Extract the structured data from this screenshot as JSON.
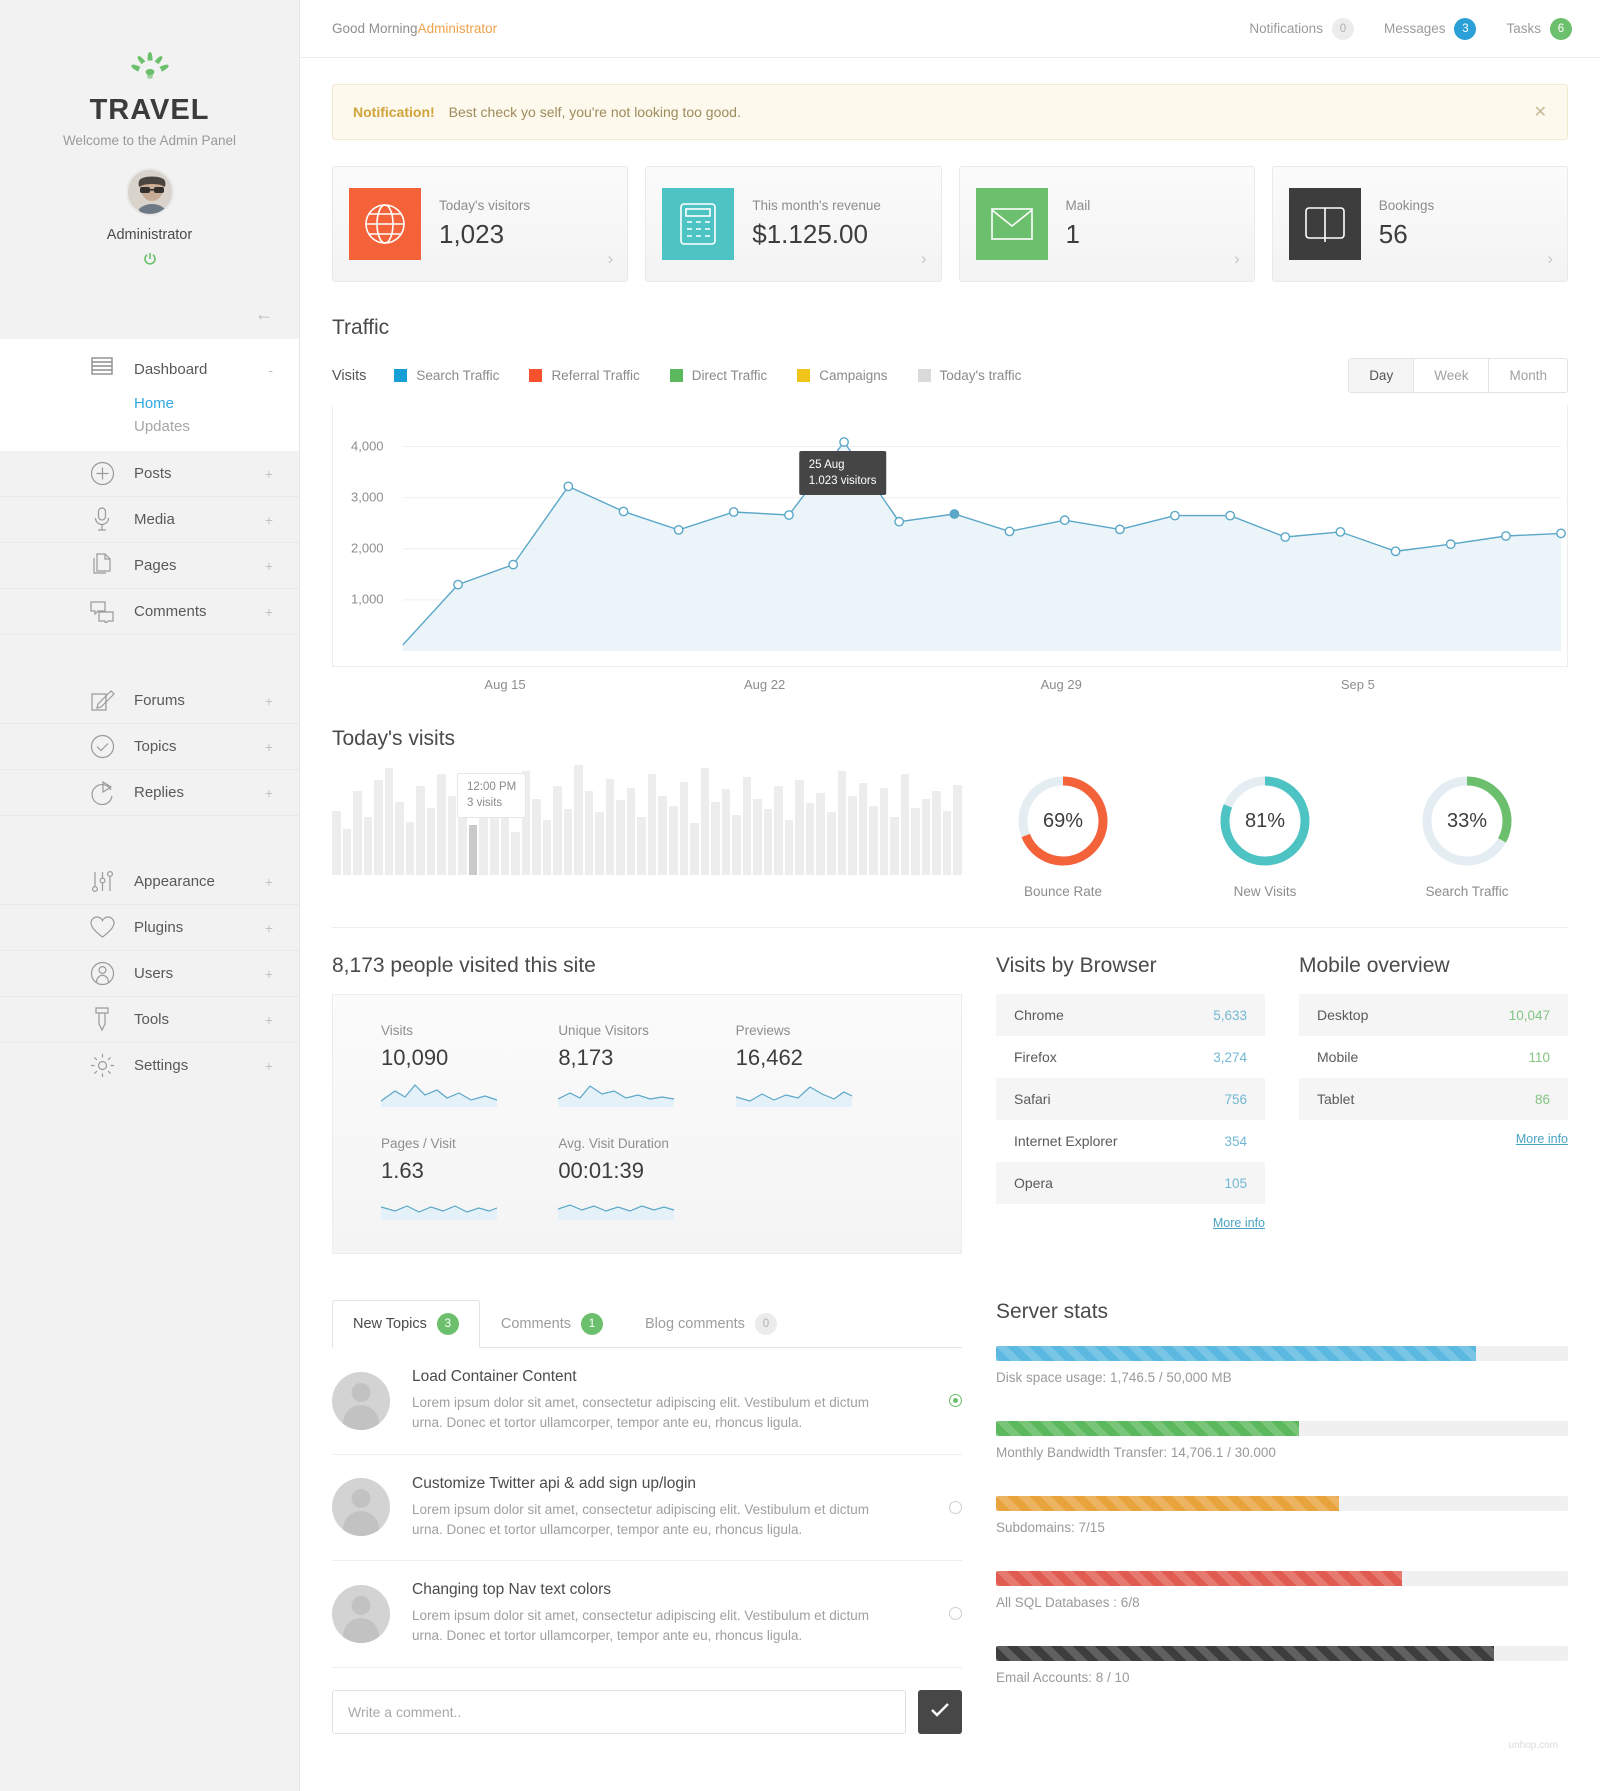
{
  "brand": {
    "name": "TRAVEL",
    "tagline": "Welcome to the Admin Panel",
    "user": "Administrator",
    "logo_icon": "palm-tree-icon",
    "power_icon": "power-icon",
    "collapse_icon": "arrow-left-icon"
  },
  "sidebar": {
    "dashboard": {
      "label": "Dashboard",
      "icon": "lines-icon",
      "toggle": "-",
      "sub": [
        {
          "label": "Home",
          "selected": true
        },
        {
          "label": "Updates",
          "selected": false
        }
      ]
    },
    "group1": [
      {
        "label": "Posts",
        "icon": "plus-circle-icon",
        "toggle": "+"
      },
      {
        "label": "Media",
        "icon": "microphone-icon",
        "toggle": "+"
      },
      {
        "label": "Pages",
        "icon": "pages-icon",
        "toggle": "+"
      },
      {
        "label": "Comments",
        "icon": "comments-icon",
        "toggle": "+"
      }
    ],
    "group2": [
      {
        "label": "Forums",
        "icon": "pencil-square-icon",
        "toggle": "+"
      },
      {
        "label": "Topics",
        "icon": "check-circle-icon",
        "toggle": "+"
      },
      {
        "label": "Replies",
        "icon": "reply-arrow-icon",
        "toggle": "+"
      }
    ],
    "group3": [
      {
        "label": "Appearance",
        "icon": "sliders-icon",
        "toggle": "+"
      },
      {
        "label": "Plugins",
        "icon": "heart-icon",
        "toggle": "+"
      },
      {
        "label": "Users",
        "icon": "user-icon",
        "toggle": "+"
      },
      {
        "label": "Tools",
        "icon": "tool-icon",
        "toggle": "+"
      },
      {
        "label": "Settings",
        "icon": "gear-icon",
        "toggle": "+"
      }
    ]
  },
  "topbar": {
    "greeting": "Good Morning ",
    "greeting_user": "Administrator",
    "items": [
      {
        "label": "Notifications",
        "count": "0",
        "style": "grey"
      },
      {
        "label": "Messages",
        "count": "3",
        "style": "blue"
      },
      {
        "label": "Tasks",
        "count": "6",
        "style": "green"
      }
    ]
  },
  "notification": {
    "title": "Notification!",
    "message": "Best check yo self, you're not looking too good.",
    "close_icon": "close-icon"
  },
  "cards": [
    {
      "label": "Today's visitors",
      "value": "1,023",
      "icon": "globe-icon",
      "color": "#f4623a"
    },
    {
      "label": "This month's revenue",
      "value": "$1.125.00",
      "icon": "calculator-icon",
      "color": "#4ec3c3"
    },
    {
      "label": "Mail",
      "value": "1",
      "icon": "envelope-icon",
      "color": "#6cbf6c"
    },
    {
      "label": "Bookings",
      "value": "56",
      "icon": "book-icon",
      "color": "#3d3d3d"
    }
  ],
  "traffic": {
    "title": "Traffic",
    "legend_first": "Visits",
    "legend": [
      {
        "label": "Search Traffic",
        "color": "#159fd4"
      },
      {
        "label": "Referral Traffic",
        "color": "#f4512c"
      },
      {
        "label": "Direct Traffic",
        "color": "#5cb85c"
      },
      {
        "label": "Campaigns",
        "color": "#f0c419"
      },
      {
        "label": "Today's traffic",
        "color": "#dadada"
      }
    ],
    "ranges": [
      {
        "label": "Day",
        "active": true
      },
      {
        "label": "Week",
        "active": false
      },
      {
        "label": "Month",
        "active": false
      }
    ],
    "tooltip": {
      "date": "25 Aug",
      "value": "1.023 visitors"
    }
  },
  "chart_data": {
    "type": "line",
    "title": "Traffic",
    "xlabel": "",
    "ylabel": "Visits",
    "ylim": [
      0,
      4500
    ],
    "yticks": [
      1000,
      2000,
      3000,
      4000
    ],
    "ytick_labels": [
      "1,000",
      "2,000",
      "3,000",
      "4,000"
    ],
    "xtick_labels": [
      "Aug 15",
      "Aug 22",
      "Aug 29",
      "Sep 5"
    ],
    "xtick_positions": [
      0.14,
      0.35,
      0.59,
      0.83
    ],
    "grid": true,
    "legend_position": "top",
    "series": [
      {
        "name": "Visits",
        "color": "#5aa7c8",
        "fill": "#e8f3f8",
        "values": [
          120,
          1300,
          1690,
          3220,
          2730,
          2370,
          2720,
          2660,
          4090,
          2530,
          2680,
          2340,
          2560,
          2380,
          2650,
          2650,
          2230,
          2330,
          1950,
          2090,
          2250,
          2300
        ]
      }
    ],
    "highlight_point": {
      "index": 10,
      "label": "25 Aug",
      "value": "1.023 visitors"
    }
  },
  "todays_visits": {
    "title": "Today's visits",
    "tooltip": {
      "time": "12:00 PM",
      "value": "3 visits"
    },
    "bars": [
      42,
      30,
      55,
      38,
      62,
      70,
      48,
      35,
      58,
      44,
      66,
      52,
      40,
      33,
      60,
      46,
      54,
      28,
      68,
      50,
      36,
      58,
      43,
      72,
      55,
      41,
      63,
      49,
      57,
      38,
      66,
      52,
      45,
      61,
      34,
      70,
      48,
      56,
      39,
      64,
      50,
      43,
      58,
      36,
      62,
      47,
      54,
      41,
      68,
      52,
      60,
      45,
      57,
      38,
      66,
      44,
      50,
      55,
      42,
      59
    ],
    "highlight_index": 13,
    "donuts": [
      {
        "label": "Bounce Rate",
        "value": "69%",
        "pct": 69,
        "color": "#f4623a"
      },
      {
        "label": "New Visits",
        "value": "81%",
        "pct": 81,
        "color": "#4ec3c3"
      },
      {
        "label": "Search Traffic",
        "value": "33%",
        "pct": 33,
        "color": "#6cbf6c"
      }
    ]
  },
  "analytics": {
    "title": "8,173 people visited this site",
    "stats": [
      {
        "label": "Visits",
        "value": "10,090"
      },
      {
        "label": "Unique Visitors",
        "value": "8,173"
      },
      {
        "label": "Previews",
        "value": "16,462"
      },
      {
        "label": "Pages / Visit",
        "value": "1.63"
      },
      {
        "label": "Avg. Visit Duration",
        "value": "00:01:39"
      }
    ]
  },
  "browsers": {
    "title": "Visits by Browser",
    "rows": [
      {
        "name": "Chrome",
        "value": "5,633"
      },
      {
        "name": "Firefox",
        "value": "3,274"
      },
      {
        "name": "Safari",
        "value": "756"
      },
      {
        "name": "Internet Explorer",
        "value": "354"
      },
      {
        "name": "Opera",
        "value": "105"
      }
    ],
    "more": "More info",
    "value_color": "#72b8d4"
  },
  "mobile": {
    "title": "Mobile overview",
    "rows": [
      {
        "name": "Desktop",
        "value": "10,047"
      },
      {
        "name": "Mobile",
        "value": "110"
      },
      {
        "name": "Tablet",
        "value": "86"
      }
    ],
    "more": "More info",
    "value_color": "#84c484"
  },
  "topics": {
    "tabs": [
      {
        "label": "New Topics",
        "count": "3",
        "badge": "green",
        "active": true
      },
      {
        "label": "Comments",
        "count": "1",
        "badge": "green",
        "active": false
      },
      {
        "label": "Blog comments",
        "count": "0",
        "badge": "grey",
        "active": false
      }
    ],
    "items": [
      {
        "title": "Load Container Content",
        "desc": "Lorem ipsum dolor sit amet, consectetur adipiscing elit. Vestibulum et dictum urna. Donec et tortor ullamcorper, tempor ante eu, rhoncus ligula.",
        "selected": true
      },
      {
        "title": "Customize Twitter api & add sign up/login",
        "desc": "Lorem ipsum dolor sit amet, consectetur adipiscing elit. Vestibulum et dictum urna. Donec et tortor ullamcorper, tempor ante eu, rhoncus ligula.",
        "selected": false
      },
      {
        "title": "Changing top Nav text colors",
        "desc": "Lorem ipsum dolor sit amet, consectetur adipiscing elit. Vestibulum et dictum urna. Donec et tortor ullamcorper, tempor ante eu, rhoncus ligula.",
        "selected": false
      }
    ],
    "comment_placeholder": "Write a comment..",
    "submit_icon": "check-icon"
  },
  "server": {
    "title": "Server stats",
    "items": [
      {
        "label": "Disk space usage: 1,746.5 / 50,000 MB",
        "pct": 84,
        "color": "#5bb8e0"
      },
      {
        "label": "Monthly Bandwidth Transfer: 14,706.1 / 30.000",
        "pct": 53,
        "color": "#5cb85c"
      },
      {
        "label": "Subdomains: 7/15",
        "pct": 60,
        "color": "#e8a33d"
      },
      {
        "label": "All SQL Databases : 6/8",
        "pct": 71,
        "color": "#e05c51"
      },
      {
        "label": "Email Accounts: 8 / 10",
        "pct": 87,
        "color": "#3d3d3d"
      }
    ]
  },
  "watermark": "unhop.com"
}
